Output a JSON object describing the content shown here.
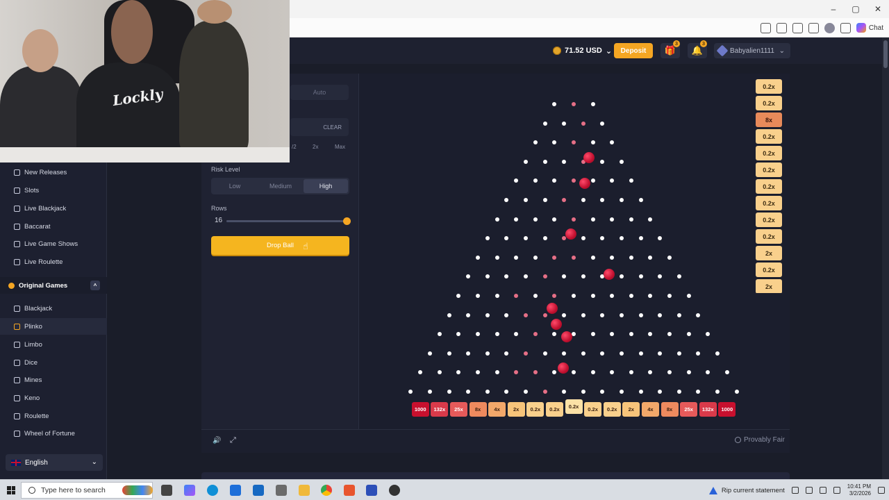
{
  "browser": {
    "window_controls": [
      "–",
      "▢",
      "✕"
    ],
    "copilot_label": "Chat"
  },
  "header": {
    "balance": "71.52 USD",
    "deposit_label": "Deposit",
    "gift_badge": "3",
    "notif_badge": "3",
    "username": "Babyalien1111"
  },
  "sidebar": {
    "items_top": [
      {
        "label": "New Releases",
        "icon": "sparkle-icon"
      },
      {
        "label": "Slots",
        "icon": "slots-icon"
      },
      {
        "label": "Live Blackjack",
        "icon": "cards-icon"
      },
      {
        "label": "Baccarat",
        "icon": "cards-icon"
      },
      {
        "label": "Live Game Shows",
        "icon": "show-icon"
      },
      {
        "label": "Live Roulette",
        "icon": "roulette-icon"
      }
    ],
    "section": {
      "label": "Original Games",
      "toggle": "^"
    },
    "items_originals": [
      {
        "label": "Blackjack",
        "icon": "cards-icon",
        "active": false
      },
      {
        "label": "Plinko",
        "icon": "plinko-icon",
        "active": true
      },
      {
        "label": "Limbo",
        "icon": "limbo-icon",
        "active": false
      },
      {
        "label": "Dice",
        "icon": "dice-icon",
        "active": false
      },
      {
        "label": "Mines",
        "icon": "mines-icon",
        "active": false
      },
      {
        "label": "Keno",
        "icon": "keno-icon",
        "active": false
      },
      {
        "label": "Roulette",
        "icon": "roulette-icon",
        "active": false
      },
      {
        "label": "Wheel of Fortune",
        "icon": "wheel-icon",
        "active": false
      }
    ],
    "language": "English"
  },
  "controls": {
    "auto_tab": "Auto",
    "clear_label": "CLEAR",
    "half_label": "/2",
    "double_label": "2x",
    "max_label": "Max",
    "risk_label": "Risk Level",
    "risk_options": [
      "Low",
      "Medium",
      "High"
    ],
    "risk_selected": "High",
    "rows_label": "Rows",
    "rows_value": "16",
    "rows_min": 8,
    "rows_max": 16,
    "drop_label": "Drop Ball"
  },
  "board": {
    "rows": 16,
    "buckets": [
      "1000",
      "132x",
      "25x",
      "8x",
      "4x",
      "2x",
      "0.2x",
      "0.2x",
      "0.2x",
      "0.2x",
      "0.2x",
      "2x",
      "4x",
      "8x",
      "25x",
      "132x",
      "1000"
    ],
    "bucket_colors": [
      "#c8102e",
      "#d93a4a",
      "#e65a5a",
      "#ee8a5e",
      "#f2a86a",
      "#f7c47a",
      "#f9d08c",
      "#f9d08c",
      "#fbe1a6",
      "#f9d08c",
      "#f9d08c",
      "#f7c47a",
      "#f2a86a",
      "#ee8a5e",
      "#e65a5a",
      "#d93a4a",
      "#c8102e"
    ],
    "active_bucket_index": 8
  },
  "history": [
    "0.2x",
    "0.2x",
    "8x",
    "0.2x",
    "0.2x",
    "0.2x",
    "0.2x",
    "0.2x",
    "0.2x",
    "0.2x",
    "2x",
    "0.2x",
    "2x"
  ],
  "footer": {
    "sound_icon": "🔊",
    "expand_icon": "⤢",
    "provably_fair": "Provably Fair"
  },
  "webcam": {
    "shirt_text": "Lockly"
  },
  "taskbar": {
    "search_placeholder": "Type here to search",
    "notification": "Rip current statement",
    "time": "10:41 PM",
    "date": "3/2/2026"
  }
}
